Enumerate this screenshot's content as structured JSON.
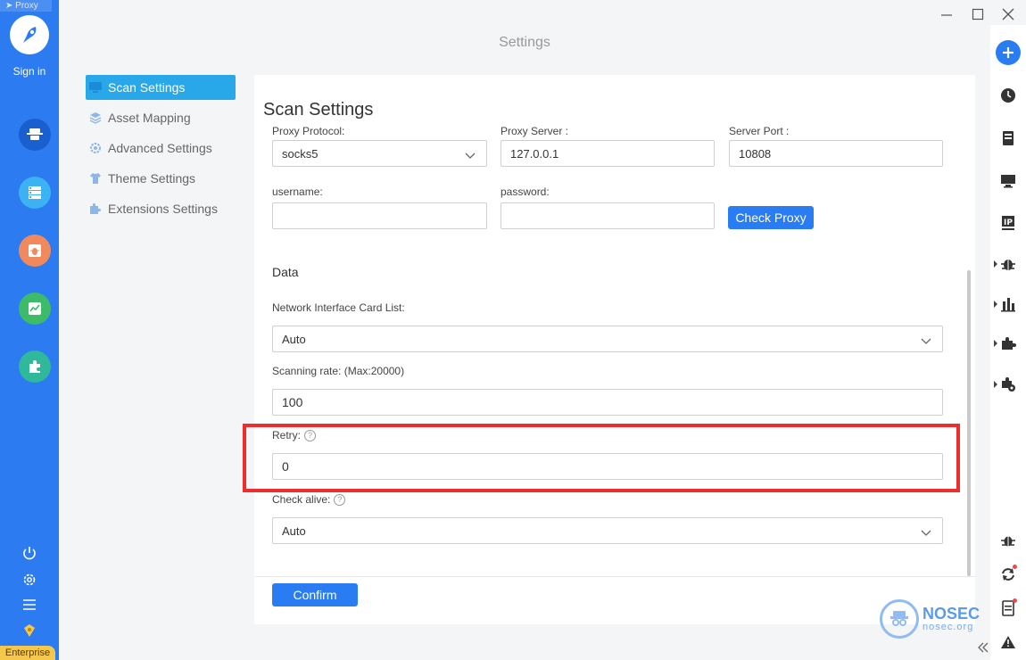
{
  "sidebar": {
    "proxy_tag": "Proxy",
    "signin": "Sign in",
    "enterprise": "Enterprise"
  },
  "window": {
    "title": "Settings"
  },
  "menu": {
    "items": [
      {
        "label": "Scan Settings"
      },
      {
        "label": "Asset Mapping"
      },
      {
        "label": "Advanced Settings"
      },
      {
        "label": "Theme Settings"
      },
      {
        "label": "Extensions Settings"
      }
    ]
  },
  "panel": {
    "title": "Scan Settings",
    "proxy_protocol_label": "Proxy Protocol:",
    "proxy_protocol_value": "socks5",
    "proxy_server_label": "Proxy Server :",
    "proxy_server_value": "127.0.0.1",
    "server_port_label": "Server Port :",
    "server_port_value": "10808",
    "username_label": "username:",
    "username_value": "",
    "password_label": "password:",
    "password_value": "",
    "check_proxy_label": "Check Proxy",
    "data_section": "Data",
    "nic_label": "Network Interface Card List:",
    "nic_value": "Auto",
    "rate_label": "Scanning rate: (Max:20000)",
    "rate_value": "100",
    "retry_label": "Retry:",
    "retry_value": "0",
    "alive_label": "Check alive:",
    "alive_value": "Auto",
    "confirm_label": "Confirm"
  },
  "watermark": {
    "brand": "NOSEC",
    "domain": "nosec.org"
  },
  "colors": {
    "accent": "#2a7cf2",
    "rail": "#2c7bf0",
    "active_menu": "#28a7e9",
    "highlight": "#ee2d2d"
  }
}
